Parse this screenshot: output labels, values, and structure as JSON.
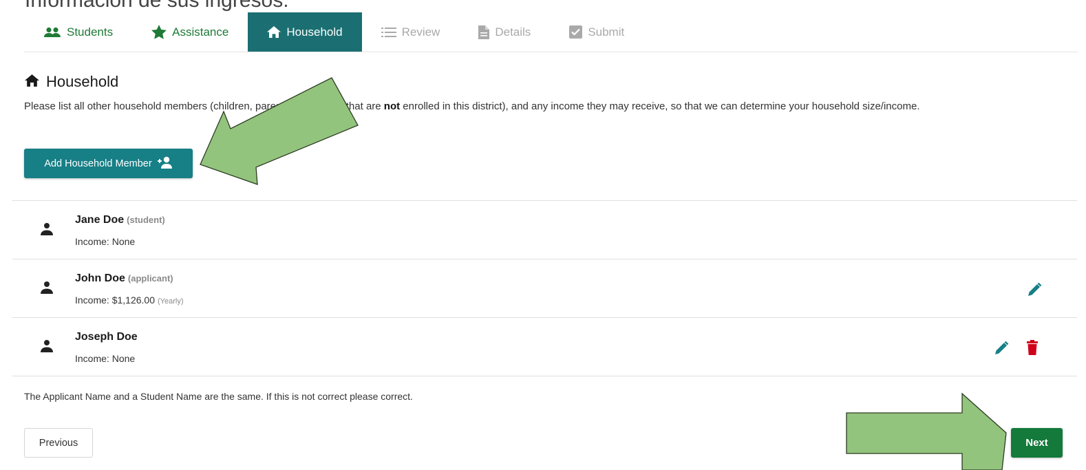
{
  "caption": "Información de sus ingresos.",
  "tabs": [
    {
      "label": "Students",
      "icon": "people-icon",
      "state": "done"
    },
    {
      "label": "Assistance",
      "icon": "star-icon",
      "state": "done"
    },
    {
      "label": "Household",
      "icon": "home-icon",
      "state": "active"
    },
    {
      "label": "Review",
      "icon": "list-icon",
      "state": "disabled"
    },
    {
      "label": "Details",
      "icon": "document-icon",
      "state": "disabled"
    },
    {
      "label": "Submit",
      "icon": "checkbox-icon",
      "state": "disabled"
    }
  ],
  "section": {
    "title": "Household",
    "desc_before": "Please list all other household members (children, parents, and adults that are ",
    "desc_bold": "not",
    "desc_after": " enrolled in this district), and any income they may receive, so that we can determine your household size/income.",
    "add_button": "Add Household Member"
  },
  "members": [
    {
      "name": "Jane Doe",
      "role": "(student)",
      "income_label": "Income:",
      "income": "None",
      "period": "",
      "editable": false,
      "deletable": false
    },
    {
      "name": "John Doe",
      "role": "(applicant)",
      "income_label": "Income:",
      "income": "$1,126.00",
      "period": "(Yearly)",
      "editable": true,
      "deletable": false
    },
    {
      "name": "Joseph Doe",
      "role": "",
      "income_label": "Income:",
      "income": "None",
      "period": "",
      "editable": true,
      "deletable": true
    }
  ],
  "warning": "The Applicant Name and a Student Name are the same. If this is not correct please correct.",
  "nav": {
    "previous": "Previous",
    "next": "Next"
  },
  "colors": {
    "tab_active": "#1b6f72",
    "tab_done": "#1e7a36",
    "primary_button": "#177f86",
    "next_button": "#137a3b",
    "edit_icon": "#177f86",
    "delete_icon": "#d0021b",
    "annotation_arrow": "#93c47d"
  }
}
